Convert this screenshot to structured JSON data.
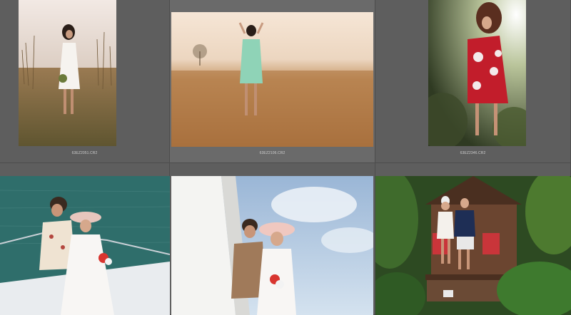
{
  "grid": {
    "cells": [
      {
        "filename": "63EZ2051.CR2",
        "thumbnail": "photo-woman-white-dress-in-dry-grass"
      },
      {
        "filename": "63EZ2106.CR2",
        "thumbnail": "photo-woman-mint-dress-in-golden-field"
      },
      {
        "filename": "63EZ2346.CR2",
        "thumbnail": "photo-woman-red-floral-dress-in-sunlight"
      },
      {
        "filename": "",
        "thumbnail": "photo-couple-on-boat-at-sea"
      },
      {
        "filename": "",
        "thumbnail": "photo-couple-on-yacht-deck-sky"
      },
      {
        "filename": "",
        "thumbnail": "photo-couple-at-wooden-hut-garden"
      }
    ]
  }
}
